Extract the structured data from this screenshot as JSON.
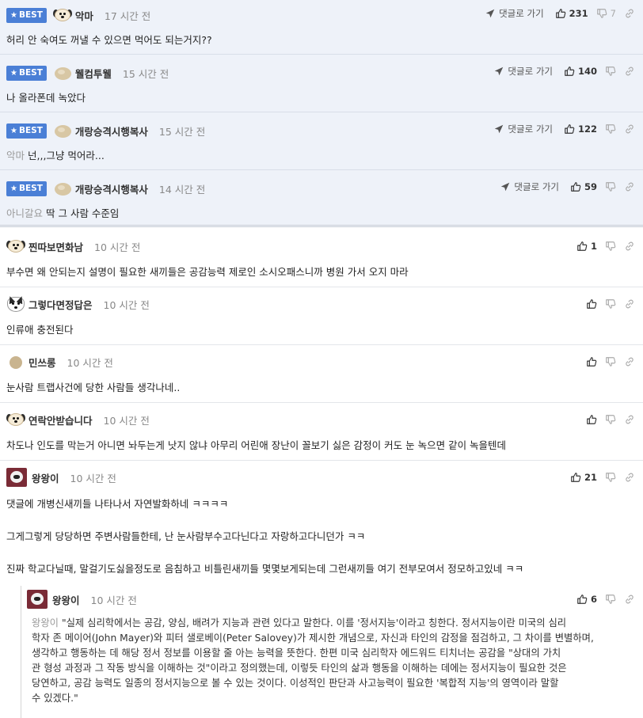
{
  "common": {
    "best_label": "BEST",
    "goto_label": "댓글로 가기"
  },
  "best_comments": [
    {
      "nick": "악마",
      "time": "17 시간 전",
      "text": "허리 안 숙여도 꺼낼 수 있으면 먹어도 되는거지??",
      "mention": "",
      "likes": "231",
      "dislikes": "7"
    },
    {
      "nick": "웰컴투웰",
      "time": "15 시간 전",
      "text": "나 올라폰데 녹았다",
      "mention": "",
      "likes": "140",
      "dislikes": ""
    },
    {
      "nick": "개랑승격시행복사",
      "time": "15 시간 전",
      "text": "넌,,,그냥 먹어라...",
      "mention": "악마",
      "likes": "122",
      "dislikes": ""
    },
    {
      "nick": "개랑승격시행복사",
      "time": "14 시간 전",
      "text": "딱 그 사람 수준임",
      "mention": "아니갈요",
      "likes": "59",
      "dislikes": ""
    }
  ],
  "comments": [
    {
      "nick": "찐따보면화남",
      "time": "10 시간 전",
      "text": "부수면 왜 안되는지 설명이 필요한 새끼들은 공감능력 제로인 소시오패스니까 병원 가서 오지 마라",
      "likes": "1"
    },
    {
      "nick": "그렇다면정답은",
      "time": "10 시간 전",
      "text": "인류애 충전된다",
      "likes": ""
    },
    {
      "nick": "민쓰롱",
      "time": "10 시간 전",
      "text": "눈사람 트랩사건에 당한 사람들 생각나네..",
      "likes": ""
    },
    {
      "nick": "연락안받습니다",
      "time": "10 시간 전",
      "text": "차도나 인도를 막는거 아니면 놔두는게 낫지 않냐 아무리 어린애 장난이 꼴보기 싫은 감정이 커도 눈 녹으면 같이 녹을텐데",
      "likes": ""
    },
    {
      "nick": "왕왕이",
      "time": "10 시간 전",
      "likes": "21",
      "lines": [
        "댓글에 개병신새끼들 나타나서 자연발화하네 ㅋㅋㅋㅋ",
        "그게그렇게 당당하면 주변사람들한테, 난 눈사람부수고다닌다고 자랑하고다니던가 ㅋㅋ",
        "진짜 학교다닐때, 말걸기도싫을정도로 음침하고 비틀린새끼들 몇몇보게되는데 그런새끼들 여기 전부모여서 정모하고있네 ㅋㅋ"
      ]
    }
  ],
  "reply": {
    "nick": "왕왕이",
    "time": "10 시간 전",
    "likes": "6",
    "mention": "왕왕이",
    "lines": [
      "\"실제 심리학에서는 공감, 양심, 배려가 지능과 관련 있다고 말한다. 이를 '정서지능'이라고 칭한다. 정서지능이란 미국의 심리",
      "학자 존 메이어(John Mayer)와 피터 샐로베이(Peter Salovey)가 제시한 개념으로, 자신과 타인의 감정을 점검하고, 그 차이를 변별하며,",
      "생각하고 행동하는 데 해당 정서 정보를 이용할 줄 아는 능력을 뜻한다. 한편 미국 심리학자 에드워드 티치너는 공감을 \"상대의 가치",
      "관 형성 과정과 그 작동 방식을 이해하는 것\"이라고 정의했는데, 이렇듯 타인의 삶과 행동을 이해하는 데에는 정서지능이 필요한 것은",
      "당연하고, 공감 능력도 일종의 정서지능으로 볼 수 있는 것이다. 이성적인 판단과 사고능력이 필요한 '복합적 지능'의 영역이라 말할",
      "수 있겠다.\""
    ]
  },
  "icons": {
    "goto": "send-arrow-icon",
    "like": "thumbs-up-icon",
    "dislike": "thumbs-down-icon",
    "link": "link-icon",
    "best": "star-icon"
  },
  "colors": {
    "best_bg": "#eef2f9",
    "badge": "#4a7fd6"
  }
}
